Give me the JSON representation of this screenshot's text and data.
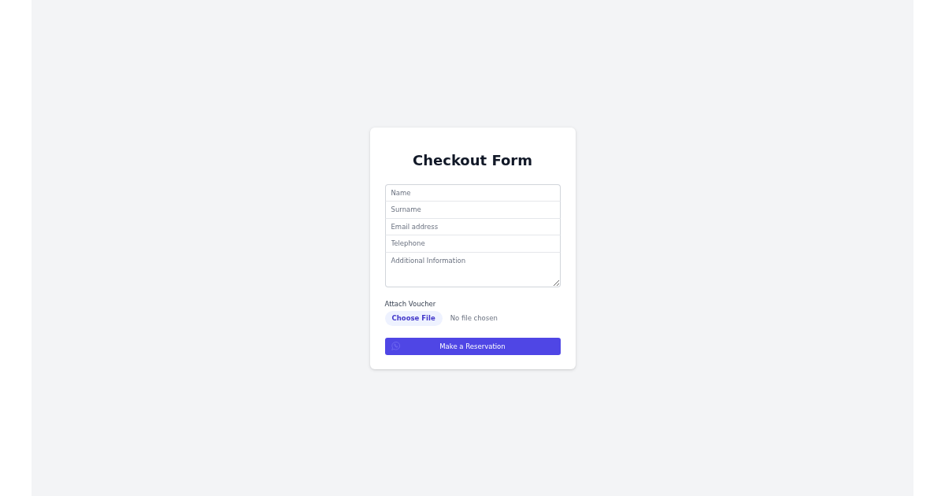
{
  "title": "Checkout Form",
  "fields": [
    {
      "kind": "input",
      "placeholder": "Name"
    },
    {
      "kind": "input",
      "placeholder": "Surname"
    },
    {
      "kind": "input",
      "placeholder": "Email address"
    },
    {
      "kind": "input",
      "placeholder": "Telephone"
    },
    {
      "kind": "textarea",
      "placeholder": "Additional Information"
    }
  ],
  "attachment": {
    "label": "Attach Voucher",
    "button": "Choose File",
    "status": "No file chosen"
  },
  "submit": {
    "label": "Make a Reservation"
  }
}
